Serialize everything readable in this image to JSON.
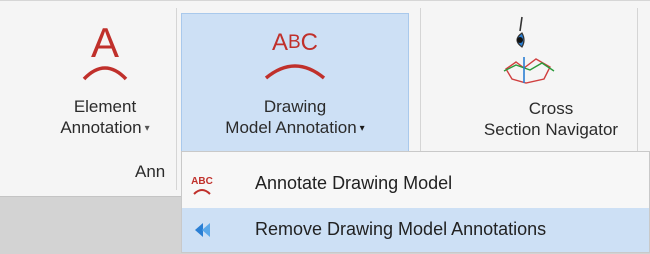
{
  "ribbon": {
    "element_annotation": {
      "line1": "Element",
      "line2": "Annotation",
      "dropdown": "▾"
    },
    "drawing_model_annotation": {
      "line1": "Drawing",
      "line2": "Model Annotation",
      "dropdown": "▾"
    },
    "cross_section_navigator": {
      "line1": "Cross",
      "line2": "Section Navigator"
    },
    "group_label": "Ann"
  },
  "menu": {
    "items": [
      {
        "label": "Annotate Drawing Model",
        "icon": "abc-arc-icon"
      },
      {
        "label": "Remove Drawing Model Annotations",
        "icon": "double-arrow-back-icon"
      }
    ]
  },
  "colors": {
    "accent_red": "#c0302b",
    "selected": "#cde0f5",
    "blue_icon": "#2a7fd4"
  }
}
